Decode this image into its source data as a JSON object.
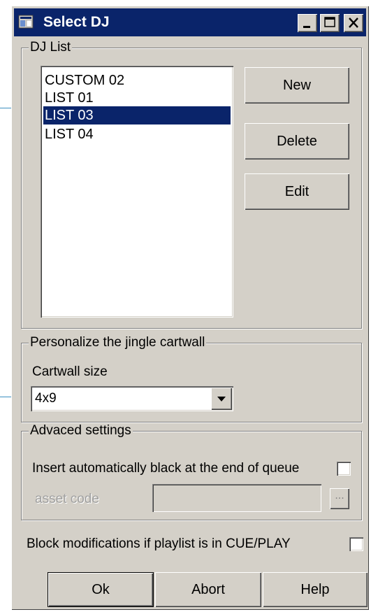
{
  "window": {
    "title": "Select DJ",
    "title_buttons": [
      "minimize-icon",
      "maximize-icon",
      "close-icon"
    ]
  },
  "dj_list": {
    "legend": "DJ List",
    "items": [
      {
        "label": "CUSTOM 02",
        "selected": false
      },
      {
        "label": "LIST 01",
        "selected": false
      },
      {
        "label": "LIST 03",
        "selected": true
      },
      {
        "label": "LIST 04",
        "selected": false
      }
    ],
    "buttons": {
      "new": "New",
      "delete": "Delete",
      "edit": "Edit"
    }
  },
  "cartwall": {
    "legend": "Personalize the jingle cartwall",
    "size_label": "Cartwall size",
    "size_value": "4x9"
  },
  "advanced": {
    "legend": "Advaced settings",
    "insert_black_label": "Insert automatically black at the end of queue",
    "insert_black_checked": false,
    "asset_code_label": "asset code",
    "asset_code_value": "",
    "browse_label": "..."
  },
  "block_mod": {
    "label": "Block modifications if playlist is in CUE/PLAY",
    "checked": false
  },
  "footer": {
    "ok": "Ok",
    "abort": "Abort",
    "help": "Help"
  },
  "colors": {
    "title_bar": "#0a246a",
    "selection": "#0a246a",
    "face": "#d4d0c8",
    "pointer_line": "#3c8fc0"
  }
}
